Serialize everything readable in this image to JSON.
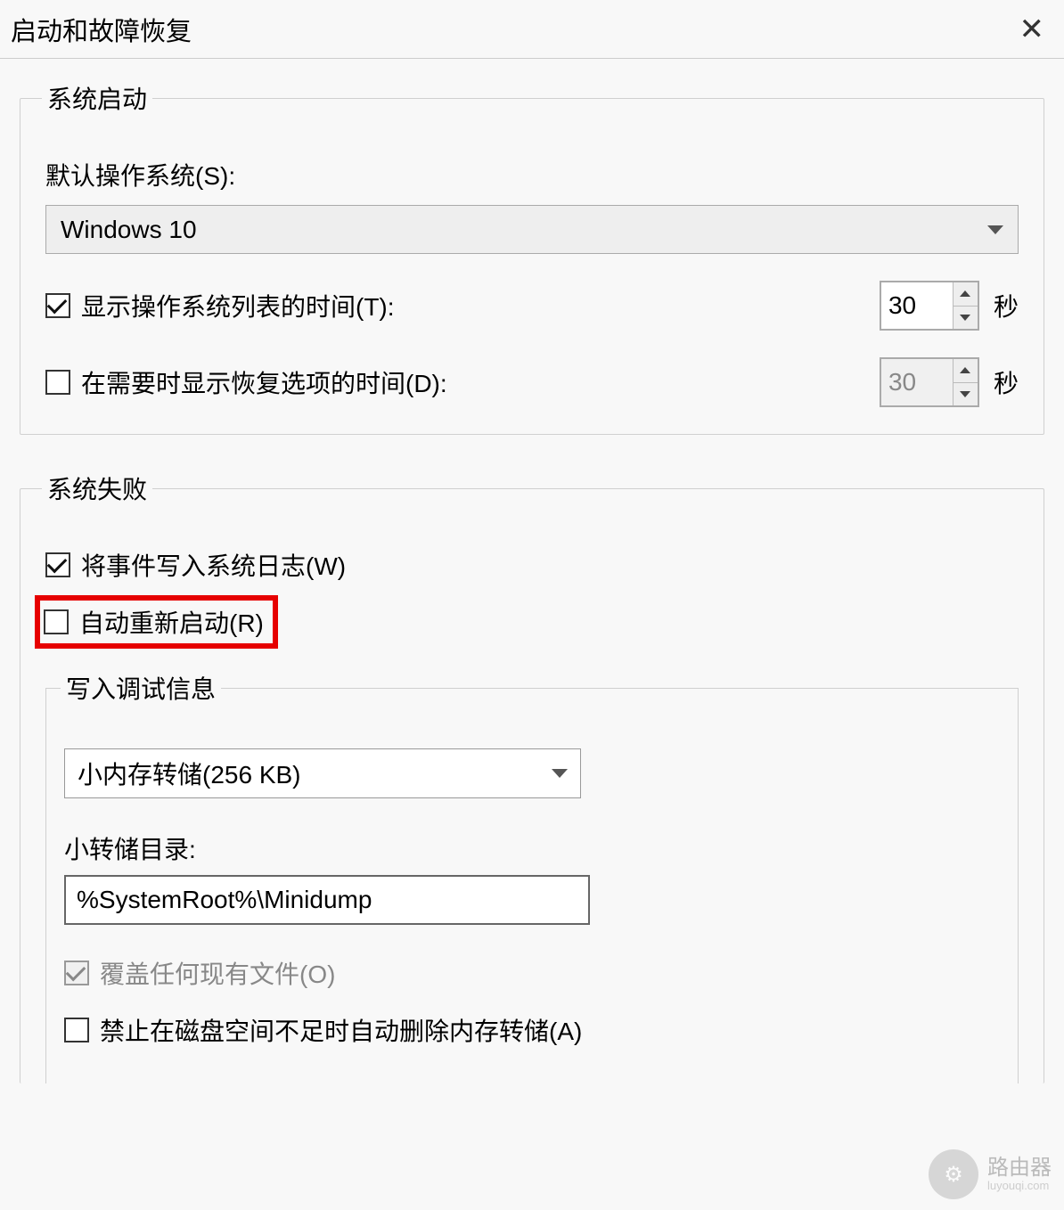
{
  "title": "启动和故障恢复",
  "sections": {
    "startup": {
      "legend": "系统启动",
      "default_os_label": "默认操作系统(S):",
      "default_os_value": "Windows 10",
      "show_os_list": {
        "label": "显示操作系统列表的时间(T):",
        "checked": true,
        "value": "30",
        "unit": "秒"
      },
      "show_recovery": {
        "label": "在需要时显示恢复选项的时间(D):",
        "checked": false,
        "value": "30",
        "unit": "秒"
      }
    },
    "failure": {
      "legend": "系统失败",
      "write_event": {
        "label": "将事件写入系统日志(W)",
        "checked": true
      },
      "auto_restart": {
        "label": "自动重新启动(R)",
        "checked": false
      },
      "debug": {
        "legend": "写入调试信息",
        "dump_type": "小内存转储(256 KB)",
        "dump_dir_label": "小转储目录:",
        "dump_dir_value": "%SystemRoot%\\Minidump",
        "overwrite": {
          "label": "覆盖任何现有文件(O)",
          "checked": true,
          "disabled": true
        },
        "no_auto_delete": {
          "label": "禁止在磁盘空间不足时自动删除内存转储(A)",
          "checked": false
        }
      }
    }
  },
  "watermark": {
    "main": "路由器",
    "sub": "luyouqi.com"
  }
}
